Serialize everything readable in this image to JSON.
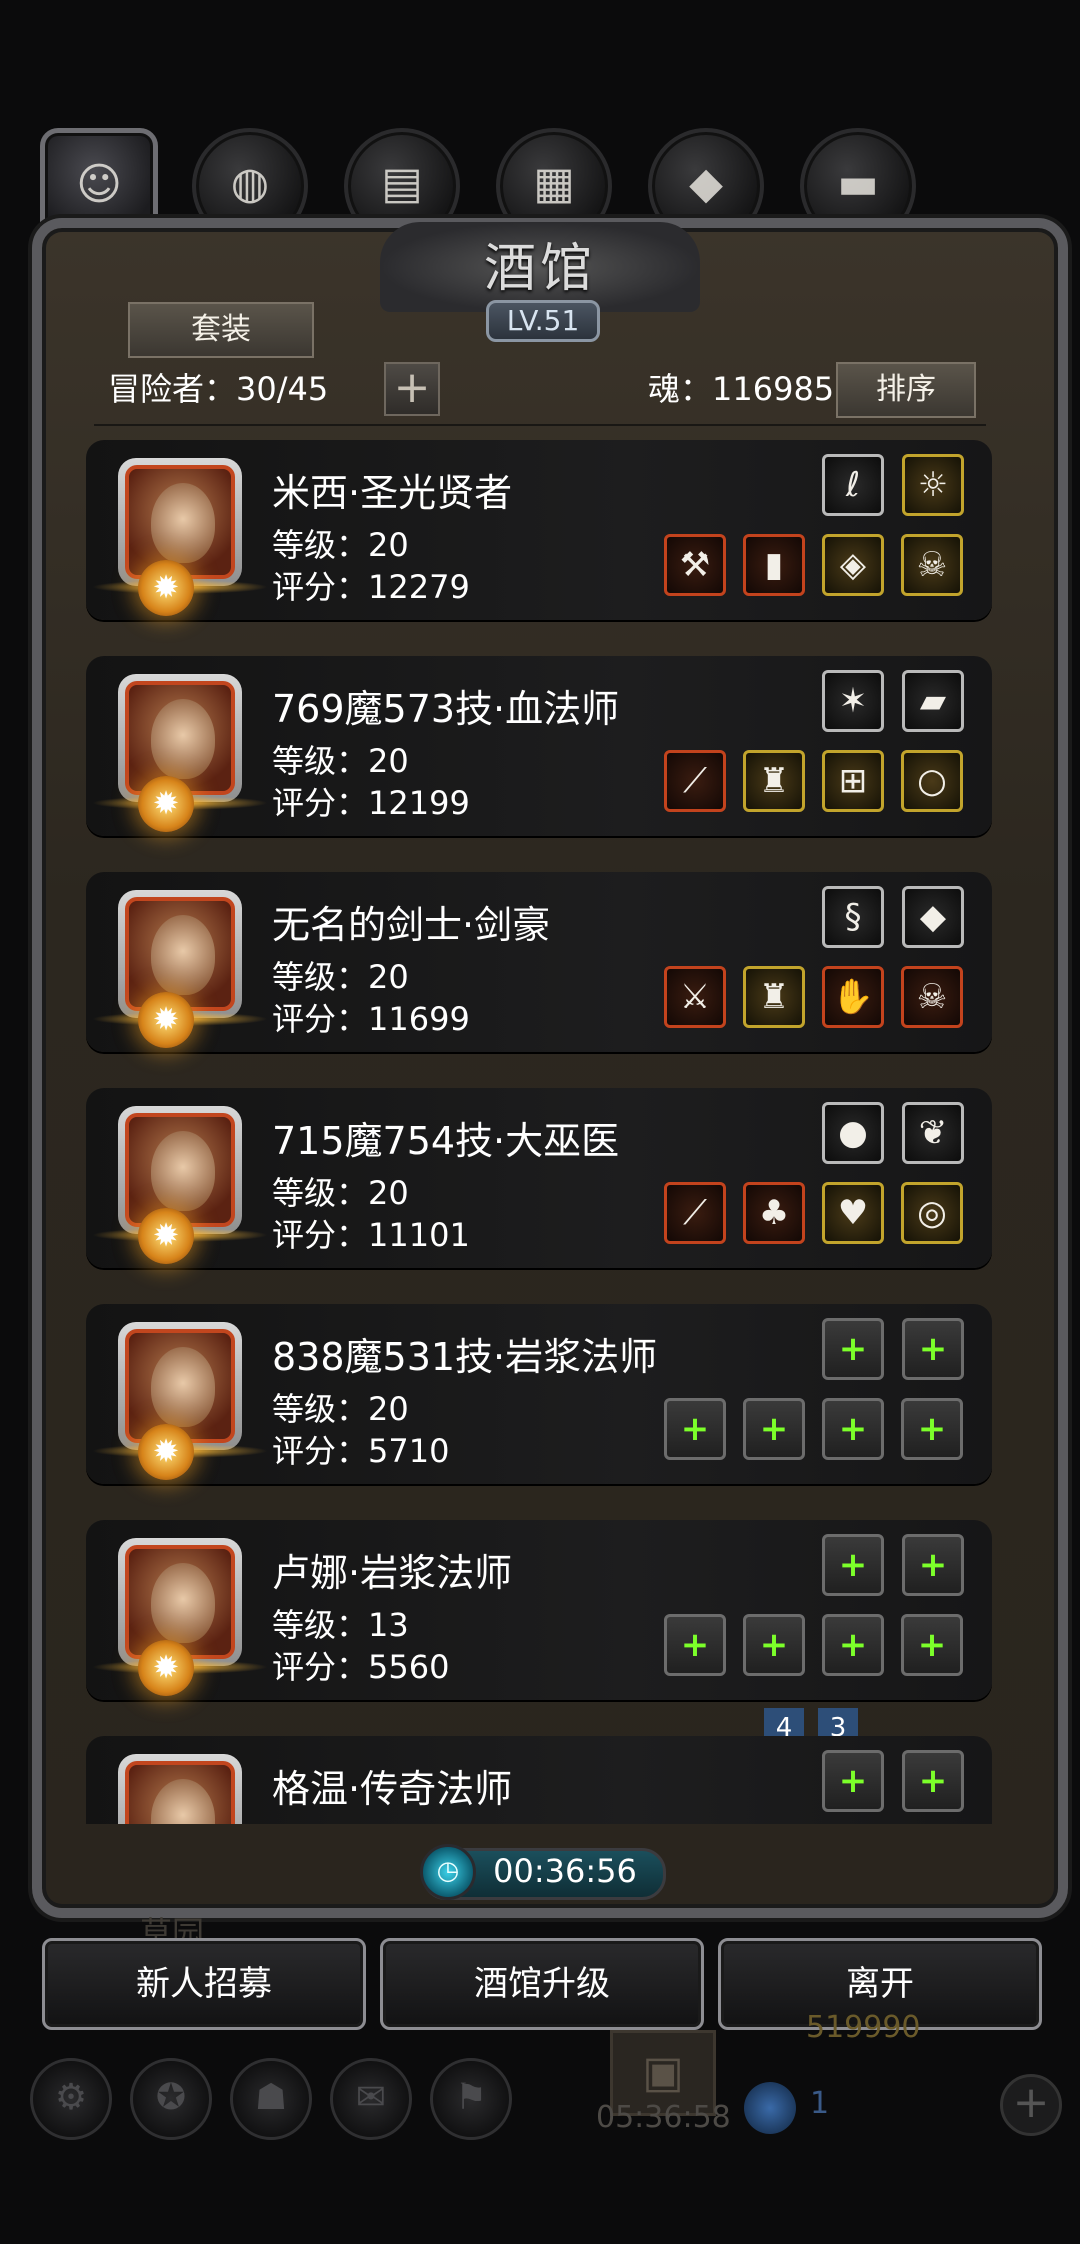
{
  "tabs": [
    {
      "icon": "hero-portrait-icon",
      "glyph": "☺",
      "selected": true
    },
    {
      "icon": "basketball-icon",
      "glyph": "◍",
      "selected": false
    },
    {
      "icon": "wood-planks-icon",
      "glyph": "▤",
      "selected": false
    },
    {
      "icon": "stone-blocks-icon",
      "glyph": "▦",
      "selected": false
    },
    {
      "icon": "blue-crystal-icon",
      "glyph": "◆",
      "selected": false
    },
    {
      "icon": "iron-ingot-icon",
      "glyph": "▬",
      "selected": false
    }
  ],
  "header": {
    "title": "酒馆",
    "level": "LV.51",
    "set_button": "套装",
    "adventurers": "冒险者：30/45",
    "add_symbol": "+",
    "soul": "魂：116985",
    "sort_button": "排序"
  },
  "heroes": [
    {
      "name": "米西·圣光贤者",
      "level": "等级：20",
      "score": "评分：12279",
      "slots_top": [
        {
          "icon": "necklace-icon",
          "glyph": "ℓ",
          "tier": "silver"
        },
        {
          "icon": "lantern-icon",
          "glyph": "☼",
          "tier": "gold"
        }
      ],
      "slots_bottom": [
        {
          "icon": "hammer-icon",
          "glyph": "⚒",
          "tier": "red"
        },
        {
          "icon": "tower-shield-icon",
          "glyph": "▮",
          "tier": "red"
        },
        {
          "icon": "green-gem-icon",
          "glyph": "◈",
          "tier": "gold"
        },
        {
          "icon": "skull-mask-icon",
          "glyph": "☠",
          "tier": "gold"
        }
      ]
    },
    {
      "name": "769魔573技·血法师",
      "level": "等级：20",
      "score": "评分：12199",
      "slots_top": [
        {
          "icon": "coral-branch-icon",
          "glyph": "✶",
          "tier": "silver"
        },
        {
          "icon": "green-card-icon",
          "glyph": "▰",
          "tier": "silver"
        }
      ],
      "slots_bottom": [
        {
          "icon": "staff-icon",
          "glyph": "⟋",
          "tier": "red"
        },
        {
          "icon": "hood-armor-icon",
          "glyph": "♜",
          "tier": "gold"
        },
        {
          "icon": "backpack-icon",
          "glyph": "⊞",
          "tier": "gold"
        },
        {
          "icon": "ring-icon",
          "glyph": "○",
          "tier": "gold"
        }
      ]
    },
    {
      "name": "无名的剑士·剑豪",
      "level": "等级：20",
      "score": "评分：11699",
      "slots_top": [
        {
          "icon": "green-dragon-icon",
          "glyph": "§",
          "tier": "silver"
        },
        {
          "icon": "red-ruby-icon",
          "glyph": "◆",
          "tier": "silver"
        }
      ],
      "slots_bottom": [
        {
          "icon": "sword-icon",
          "glyph": "⚔",
          "tier": "red"
        },
        {
          "icon": "plate-armor-icon",
          "glyph": "♜",
          "tier": "gold"
        },
        {
          "icon": "blue-gauntlet-icon",
          "glyph": "✋",
          "tier": "red"
        },
        {
          "icon": "red-skull-icon",
          "glyph": "☠",
          "tier": "red"
        }
      ]
    },
    {
      "name": "715魔754技·大巫医",
      "level": "等级：20",
      "score": "评分：11101",
      "slots_top": [
        {
          "icon": "red-amulet-icon",
          "glyph": "●",
          "tier": "silver"
        },
        {
          "icon": "leaf-icon",
          "glyph": "❦",
          "tier": "silver"
        }
      ],
      "slots_bottom": [
        {
          "icon": "wand-icon",
          "glyph": "⟋",
          "tier": "red"
        },
        {
          "icon": "green-robe-icon",
          "glyph": "♣",
          "tier": "red"
        },
        {
          "icon": "heart-pendant-icon",
          "glyph": "♥",
          "tier": "gold"
        },
        {
          "icon": "purple-ring-icon",
          "glyph": "◎",
          "tier": "gold"
        }
      ]
    },
    {
      "name": "838魔531技·岩浆法师",
      "level": "等级：20",
      "score": "评分：5710",
      "slots_top": [
        {
          "icon": "empty-slot-plus-icon",
          "glyph": "+",
          "tier": "empty"
        },
        {
          "icon": "empty-slot-plus-icon",
          "glyph": "+",
          "tier": "empty"
        }
      ],
      "slots_bottom": [
        {
          "icon": "empty-slot-plus-icon",
          "glyph": "+",
          "tier": "empty"
        },
        {
          "icon": "empty-slot-plus-icon",
          "glyph": "+",
          "tier": "empty"
        },
        {
          "icon": "empty-slot-plus-icon",
          "glyph": "+",
          "tier": "empty"
        },
        {
          "icon": "empty-slot-plus-icon",
          "glyph": "+",
          "tier": "empty"
        }
      ]
    },
    {
      "name": "卢娜·岩浆法师",
      "level": "等级：13",
      "score": "评分：5560",
      "slots_top": [
        {
          "icon": "empty-slot-plus-icon",
          "glyph": "+",
          "tier": "empty"
        },
        {
          "icon": "empty-slot-plus-icon",
          "glyph": "+",
          "tier": "empty"
        }
      ],
      "slots_bottom": [
        {
          "icon": "empty-slot-plus-icon",
          "glyph": "+",
          "tier": "empty"
        },
        {
          "icon": "empty-slot-plus-icon",
          "glyph": "+",
          "tier": "empty"
        },
        {
          "icon": "empty-slot-plus-icon",
          "glyph": "+",
          "tier": "empty"
        },
        {
          "icon": "empty-slot-plus-icon",
          "glyph": "+",
          "tier": "empty"
        }
      ],
      "bookmarks": [
        "4",
        "3"
      ]
    },
    {
      "name": "格温·传奇法师",
      "level": "",
      "score": "",
      "slots_top": [
        {
          "icon": "empty-slot-plus-icon",
          "glyph": "+",
          "tier": "empty"
        },
        {
          "icon": "empty-slot-plus-icon",
          "glyph": "+",
          "tier": "empty"
        }
      ],
      "slots_bottom": []
    }
  ],
  "timer": {
    "icon": "clock-icon",
    "value": "00:36:56"
  },
  "background_label": "草园",
  "actions": {
    "recruit": "新人招募",
    "upgrade": "酒馆升级",
    "leave": "离开"
  },
  "hud": {
    "icons": [
      "gear-icon",
      "star-icon",
      "guild-icon",
      "mail-icon",
      "gift-icon"
    ],
    "gold": "519990",
    "chest_timer": "05:36:58",
    "gem_count": "1",
    "plus": "+"
  },
  "colors": {
    "accent_green": "#7cff2a",
    "frame": "#2c271f",
    "tier_gold": "#c2a42c",
    "tier_red": "#c3431d"
  }
}
